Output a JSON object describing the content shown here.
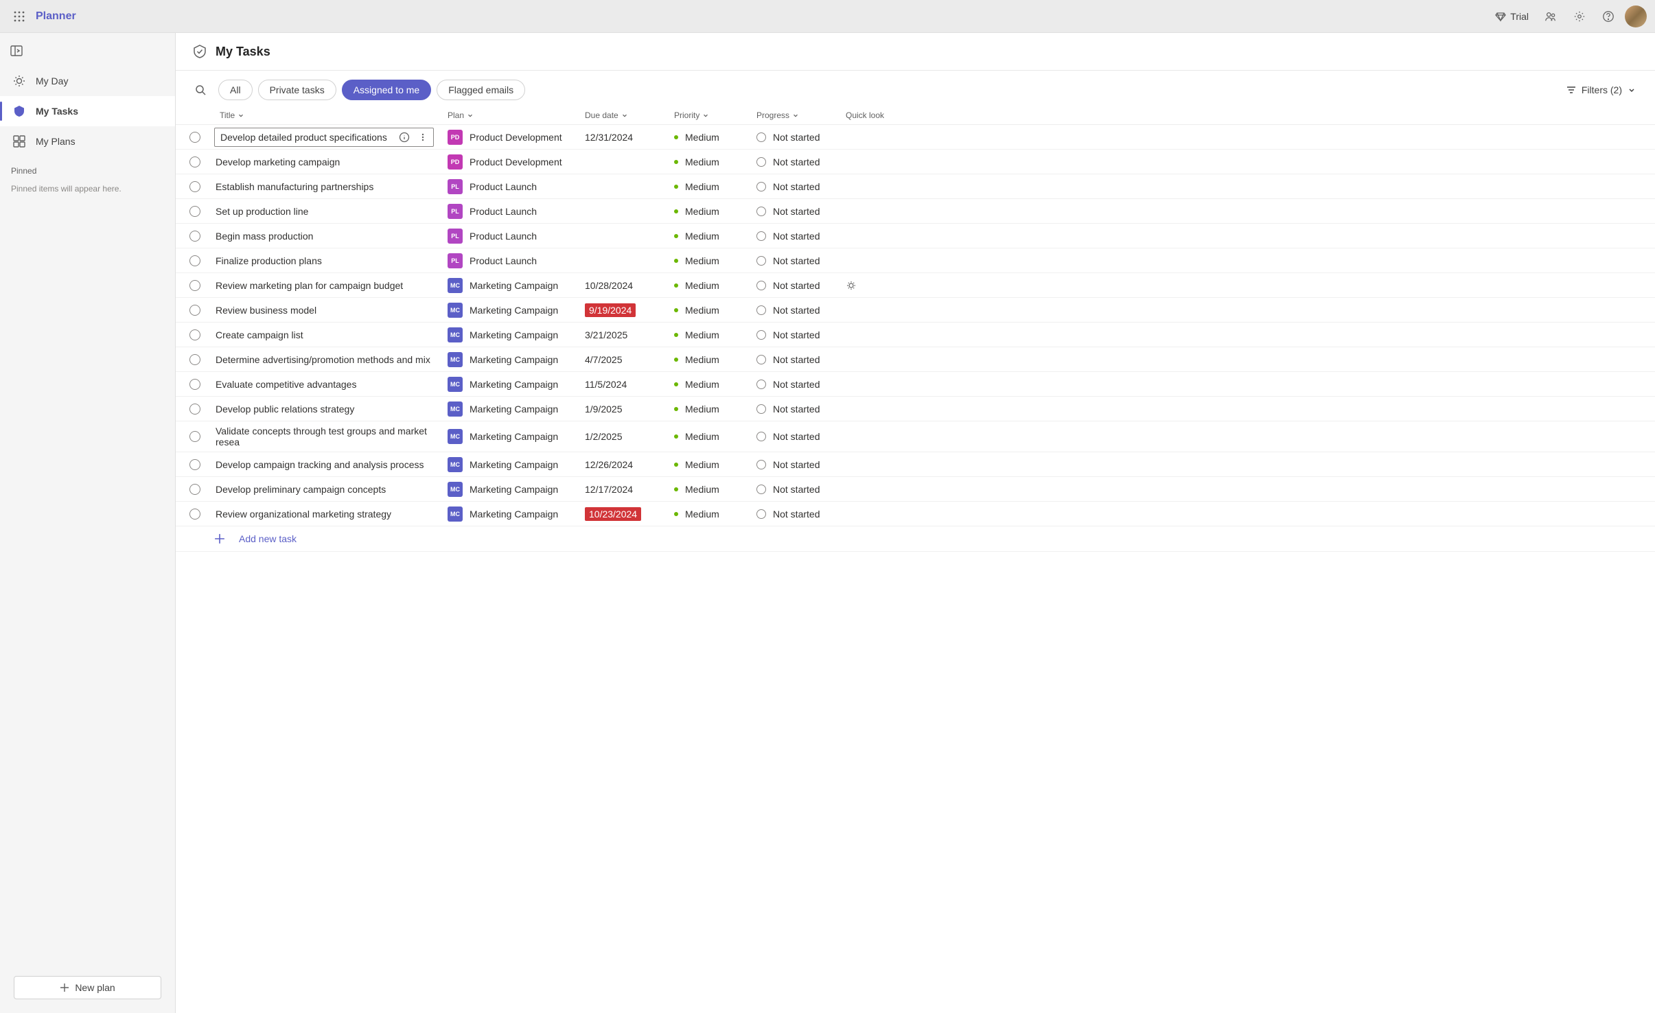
{
  "app_name": "Planner",
  "topbar": {
    "trial_label": "Trial"
  },
  "sidebar": {
    "nav": [
      {
        "label": "My Day",
        "name": "nav-my-day"
      },
      {
        "label": "My Tasks",
        "name": "nav-my-tasks"
      },
      {
        "label": "My Plans",
        "name": "nav-my-plans"
      }
    ],
    "active_index": 1,
    "pinned_header": "Pinned",
    "pinned_empty": "Pinned items will appear here.",
    "new_plan_label": "New plan"
  },
  "page": {
    "title": "My Tasks"
  },
  "toolbar": {
    "tabs": [
      {
        "label": "All"
      },
      {
        "label": "Private tasks"
      },
      {
        "label": "Assigned to me"
      },
      {
        "label": "Flagged emails"
      }
    ],
    "active_tab_index": 2,
    "filters_label": "Filters (2)"
  },
  "columns": {
    "title": "Title",
    "plan": "Plan",
    "due": "Due date",
    "priority": "Priority",
    "progress": "Progress",
    "quick": "Quick look"
  },
  "plan_badges": {
    "Product Development": {
      "initials": "PD",
      "cls": "pb-pd"
    },
    "Product Launch": {
      "initials": "PL",
      "cls": "pb-pl"
    },
    "Marketing Campaign": {
      "initials": "MC",
      "cls": "pb-mc"
    }
  },
  "tasks": [
    {
      "title": "Develop detailed product specifications",
      "plan": "Product Development",
      "due": "12/31/2024",
      "overdue": false,
      "priority": "Medium",
      "progress": "Not started",
      "selected": true,
      "quick": false
    },
    {
      "title": "Develop marketing campaign",
      "plan": "Product Development",
      "due": "",
      "overdue": false,
      "priority": "Medium",
      "progress": "Not started",
      "selected": false,
      "quick": false
    },
    {
      "title": "Establish manufacturing partnerships",
      "plan": "Product Launch",
      "due": "",
      "overdue": false,
      "priority": "Medium",
      "progress": "Not started",
      "selected": false,
      "quick": false
    },
    {
      "title": "Set up production line",
      "plan": "Product Launch",
      "due": "",
      "overdue": false,
      "priority": "Medium",
      "progress": "Not started",
      "selected": false,
      "quick": false
    },
    {
      "title": "Begin mass production",
      "plan": "Product Launch",
      "due": "",
      "overdue": false,
      "priority": "Medium",
      "progress": "Not started",
      "selected": false,
      "quick": false
    },
    {
      "title": "Finalize production plans",
      "plan": "Product Launch",
      "due": "",
      "overdue": false,
      "priority": "Medium",
      "progress": "Not started",
      "selected": false,
      "quick": false
    },
    {
      "title": "Review marketing plan for campaign budget",
      "plan": "Marketing Campaign",
      "due": "10/28/2024",
      "overdue": false,
      "priority": "Medium",
      "progress": "Not started",
      "selected": false,
      "quick": true
    },
    {
      "title": "Review business model",
      "plan": "Marketing Campaign",
      "due": "9/19/2024",
      "overdue": true,
      "priority": "Medium",
      "progress": "Not started",
      "selected": false,
      "quick": false
    },
    {
      "title": "Create campaign list",
      "plan": "Marketing Campaign",
      "due": "3/21/2025",
      "overdue": false,
      "priority": "Medium",
      "progress": "Not started",
      "selected": false,
      "quick": false
    },
    {
      "title": "Determine advertising/promotion methods and mix",
      "plan": "Marketing Campaign",
      "due": "4/7/2025",
      "overdue": false,
      "priority": "Medium",
      "progress": "Not started",
      "selected": false,
      "quick": false
    },
    {
      "title": "Evaluate competitive advantages",
      "plan": "Marketing Campaign",
      "due": "11/5/2024",
      "overdue": false,
      "priority": "Medium",
      "progress": "Not started",
      "selected": false,
      "quick": false
    },
    {
      "title": "Develop public relations strategy",
      "plan": "Marketing Campaign",
      "due": "1/9/2025",
      "overdue": false,
      "priority": "Medium",
      "progress": "Not started",
      "selected": false,
      "quick": false
    },
    {
      "title": "Validate concepts through test groups and market resea",
      "plan": "Marketing Campaign",
      "due": "1/2/2025",
      "overdue": false,
      "priority": "Medium",
      "progress": "Not started",
      "selected": false,
      "quick": false
    },
    {
      "title": "Develop campaign tracking and analysis process",
      "plan": "Marketing Campaign",
      "due": "12/26/2024",
      "overdue": false,
      "priority": "Medium",
      "progress": "Not started",
      "selected": false,
      "quick": false
    },
    {
      "title": "Develop preliminary campaign concepts",
      "plan": "Marketing Campaign",
      "due": "12/17/2024",
      "overdue": false,
      "priority": "Medium",
      "progress": "Not started",
      "selected": false,
      "quick": false
    },
    {
      "title": "Review organizational marketing strategy",
      "plan": "Marketing Campaign",
      "due": "10/23/2024",
      "overdue": true,
      "priority": "Medium",
      "progress": "Not started",
      "selected": false,
      "quick": false
    }
  ],
  "add_new_label": "Add new task"
}
